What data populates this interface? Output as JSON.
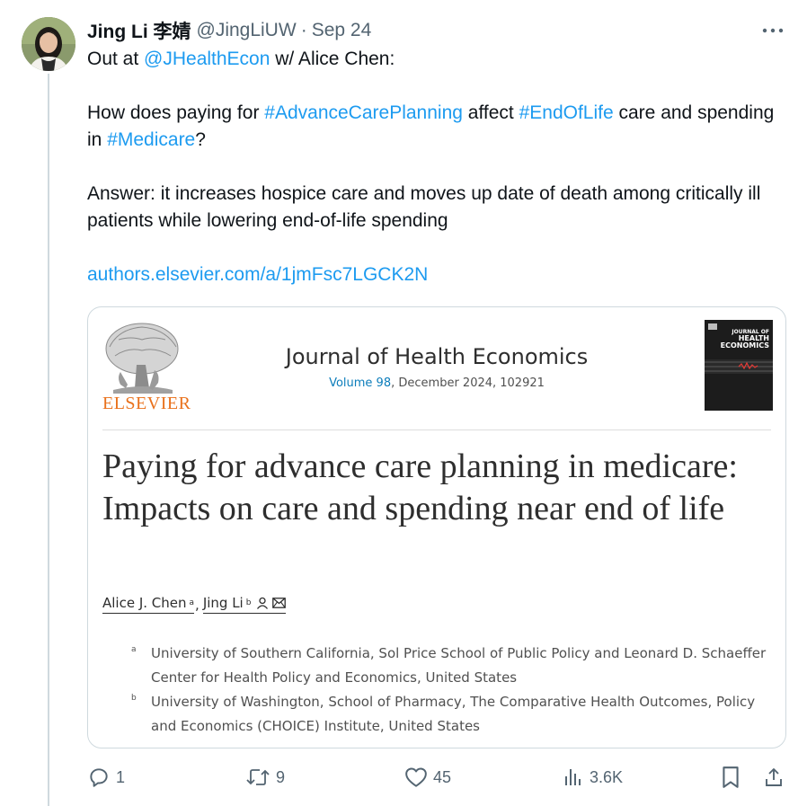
{
  "user": {
    "display_name": "Jing Li 李婧",
    "handle": "@JingLiUW",
    "separator": "·",
    "date": "Sep 24"
  },
  "tweet": {
    "line1_prefix": "Out at ",
    "line1_mention": "@JHealthEcon",
    "line1_suffix": " w/ Alice Chen:",
    "q_prefix": "How does paying for ",
    "q_tag1": "#AdvanceCarePlanning",
    "q_mid1": " affect ",
    "q_tag2": "#EndOfLife",
    "q_mid2": " care and spending in ",
    "q_tag3": "#Medicare",
    "q_suffix": "?",
    "answer": "Answer: it increases hospice care and moves up date of death among critically ill patients while lowering end-of-life spending",
    "link": "authors.elsevier.com/a/1jmFsc7LGCK2N"
  },
  "card": {
    "publisher": "ELSEVIER",
    "journal_title": "Journal of Health Economics",
    "volume": "Volume 98",
    "issue_info": ", December 2024, 102921",
    "cover_line1": "JOURNAL OF",
    "cover_line2": "HEALTH",
    "cover_line3": "ECONOMICS",
    "article_title": "Paying for advance care planning in medicare: Impacts on care and spending near end of life",
    "author1": "Alice J. Chen",
    "author1_mark": "a",
    "author_sep": ",",
    "author2": "Jing Li",
    "author2_mark": "b",
    "affil_a_mark": "a",
    "affil_a": "University of Southern California, Sol Price School of Public Policy and Leonard D. Schaeffer Center for Health Policy and Economics, United States",
    "affil_b_mark": "b",
    "affil_b": "University of Washington, School of Pharmacy, The Comparative Health Outcomes, Policy and Economics (CHOICE) Institute, United States"
  },
  "actions": {
    "replies": "1",
    "reposts": "9",
    "likes": "45",
    "views": "3.6K"
  },
  "colors": {
    "link": "#1d9bf0",
    "text": "#0f1419",
    "muted": "#536471",
    "elsevier_orange": "#e9711c"
  },
  "icons": [
    "more-icon",
    "reply-icon",
    "repost-icon",
    "like-icon",
    "views-icon",
    "bookmark-icon",
    "share-icon",
    "person-icon",
    "mail-icon"
  ]
}
